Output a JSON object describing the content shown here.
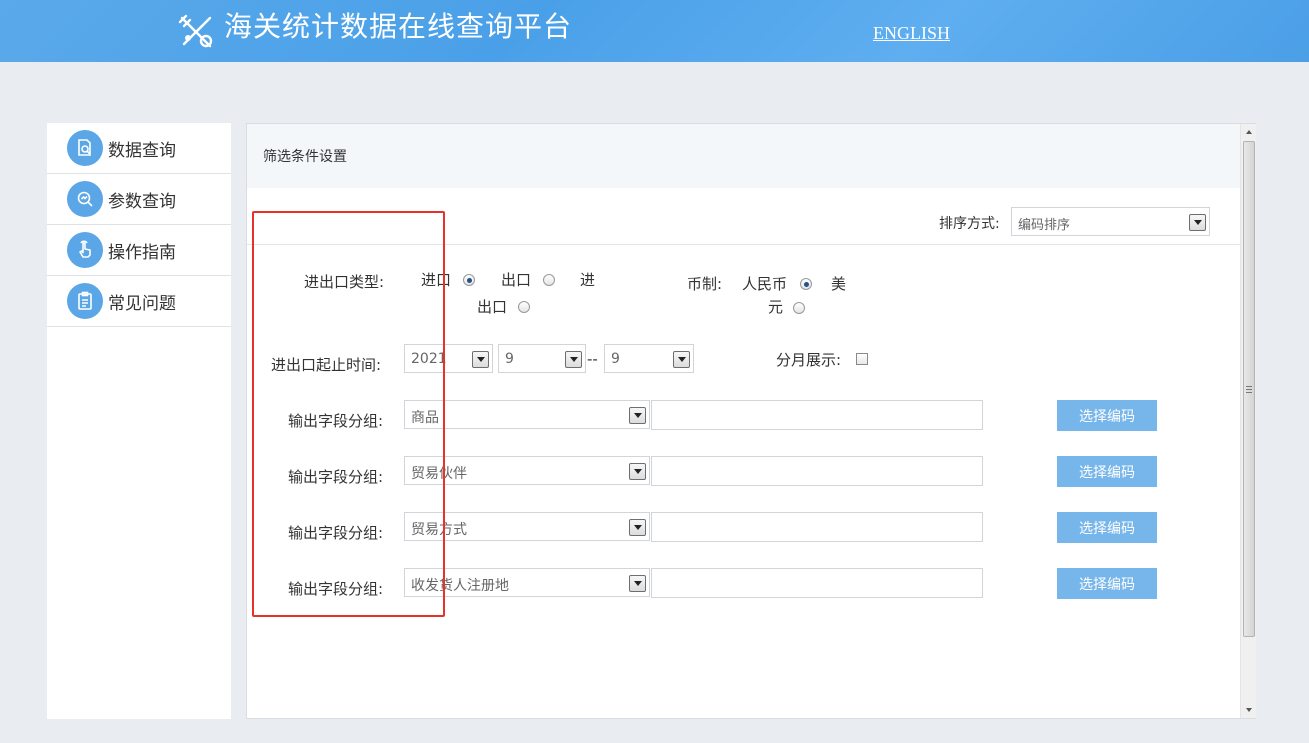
{
  "header": {
    "title": "海关统计数据在线查询平台",
    "lang_link": "ENGLISH",
    "bg_color": "#4aa0e8"
  },
  "sidebar": {
    "items": [
      {
        "label": "数据查询",
        "icon": "data-search-icon"
      },
      {
        "label": "参数查询",
        "icon": "param-search-icon"
      },
      {
        "label": "操作指南",
        "icon": "hand-pointer-icon"
      },
      {
        "label": "常见问题",
        "icon": "clipboard-icon"
      }
    ]
  },
  "panel": {
    "title": "筛选条件设置",
    "sort": {
      "label": "排序方式:",
      "value": "编码排序"
    },
    "trade_type": {
      "label": "进出口类型:",
      "options": [
        "进口",
        "出口",
        "进出口"
      ],
      "option3_part1": "进",
      "option3_part2": "出口",
      "selected": "进口"
    },
    "currency": {
      "label": "币制:",
      "options": [
        "人民币",
        "美元"
      ],
      "option2_part1": "美",
      "option2_part2": "元",
      "selected": "人民币"
    },
    "time": {
      "label": "进出口起止时间:",
      "year": "2021",
      "month_start": "9",
      "separator": "--",
      "month_end": "9"
    },
    "monthly": {
      "label": "分月展示:",
      "checked": false
    },
    "groups": [
      {
        "label": "输出字段分组:",
        "value": "商品",
        "code": "",
        "button": "选择编码"
      },
      {
        "label": "输出字段分组:",
        "value": "贸易伙伴",
        "code": "",
        "button": "选择编码"
      },
      {
        "label": "输出字段分组:",
        "value": "贸易方式",
        "code": "",
        "button": "选择编码"
      },
      {
        "label": "输出字段分组:",
        "value": "收发货人注册地",
        "code": "",
        "button": "选择编码"
      }
    ]
  },
  "colors": {
    "accent": "#5aa6e6",
    "button": "#77b6ea",
    "highlight": "#e4332a"
  }
}
